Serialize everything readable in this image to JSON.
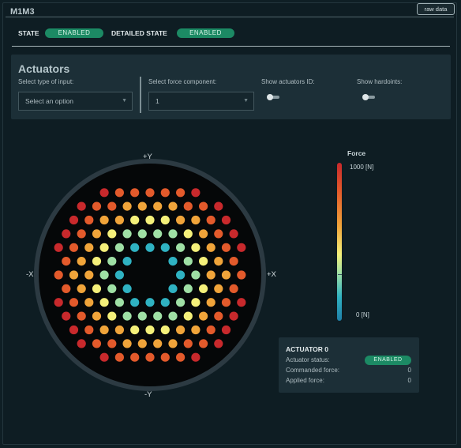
{
  "header": {
    "title": "M1M3",
    "raw_button": "raw data"
  },
  "state": {
    "state_label": "STATE",
    "state_value": "ENABLED",
    "detailed_label": "DETAILED STATE",
    "detailed_value": "ENABLED"
  },
  "actuators": {
    "title": "Actuators",
    "input_type_label": "Select type of input:",
    "input_type_placeholder": "Select an option",
    "force_component_label": "Select force component:",
    "force_component_value": "1",
    "show_ids_label": "Show actuators ID:",
    "show_ids_on": false,
    "show_hardpoints_label": "Show hardoints:",
    "show_hardpoints_on": false
  },
  "map": {
    "axis_top": "+Y",
    "axis_bottom": "-Y",
    "axis_left": "-X",
    "axis_right": "+X"
  },
  "colorbar": {
    "title": "Force",
    "max_label": "1000 [N]",
    "min_label": "0 [N]",
    "colors": [
      "#c8292c",
      "#e35a2b",
      "#f0a43a",
      "#f4f07a",
      "#9fe0a5",
      "#2fb2c2",
      "#1f7fa8"
    ]
  },
  "selected_actuator": {
    "title": "ACTUATOR 0",
    "status_label": "Actuator status:",
    "status_value": "ENABLED",
    "commanded_label": "Commanded force:",
    "commanded_value": "0",
    "applied_label": "Applied force:",
    "applied_value": "0"
  }
}
